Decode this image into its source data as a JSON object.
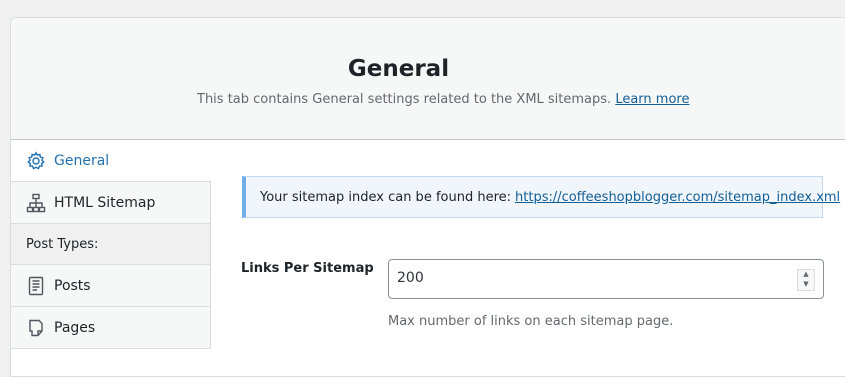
{
  "header": {
    "title": "General",
    "subtitle": "This tab contains General settings related to the XML sitemaps.",
    "learn_more": "Learn more"
  },
  "sidebar": {
    "items": [
      {
        "label": "General",
        "icon": "gear-icon",
        "active": true
      },
      {
        "label": "HTML Sitemap",
        "icon": "sitemap-icon"
      },
      {
        "label": "Post Types:",
        "group": true
      },
      {
        "label": "Posts",
        "icon": "post-icon"
      },
      {
        "label": "Pages",
        "icon": "page-icon"
      }
    ]
  },
  "notice": {
    "text": "Your sitemap index can be found here:",
    "link": "https://coffeeshopblogger.com/sitemap_index.xml"
  },
  "links_per_sitemap": {
    "label": "Links Per Sitemap",
    "value": "200",
    "help": "Max number of links on each sitemap page."
  },
  "colors": {
    "accent": "#2271b1",
    "link": "#135e96",
    "notice_border": "#72aee6"
  }
}
